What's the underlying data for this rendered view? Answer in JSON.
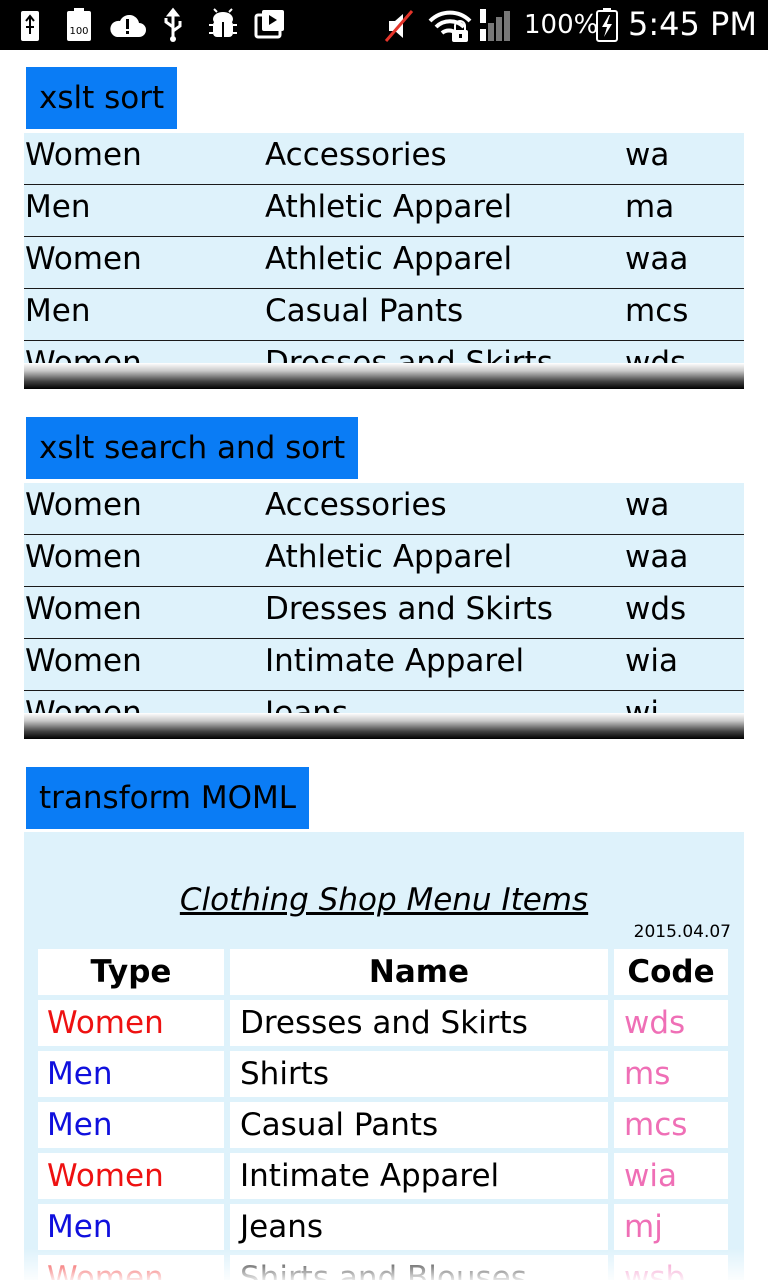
{
  "status_bar": {
    "battery_percent": "100%",
    "time": "5:45 PM",
    "icons": [
      "usb-icon",
      "battery-100-icon",
      "cloud-alert-icon",
      "usb-debug-icon",
      "android-bug-icon",
      "media-play-icon",
      "mute-icon",
      "wifi-lock-icon",
      "signal-icon",
      "charging-battery-icon"
    ]
  },
  "sections": [
    {
      "button_label": "xslt sort",
      "rows": [
        [
          "Women",
          "Accessories",
          "wa"
        ],
        [
          "Men",
          "Athletic Apparel",
          "ma"
        ],
        [
          "Women",
          "Athletic Apparel",
          "waa"
        ],
        [
          "Men",
          "Casual Pants",
          "mcs"
        ],
        [
          "Women",
          "Dresses and Skirts",
          "wds"
        ]
      ]
    },
    {
      "button_label": "xslt search and sort",
      "rows": [
        [
          "Women",
          "Accessories",
          "wa"
        ],
        [
          "Women",
          "Athletic Apparel",
          "waa"
        ],
        [
          "Women",
          "Dresses and Skirts",
          "wds"
        ],
        [
          "Women",
          "Intimate Apparel",
          "wia"
        ],
        [
          "Women",
          "Jeans",
          "wj"
        ]
      ]
    }
  ],
  "moml": {
    "button_label": "transform MOML",
    "title": "Clothing Shop Menu Items",
    "date": "2015.04.07",
    "headers": [
      "Type",
      "Name",
      "Code"
    ],
    "rows": [
      {
        "type": "Women",
        "name": "Dresses and Skirts",
        "code": "wds"
      },
      {
        "type": "Men",
        "name": "Shirts",
        "code": "ms"
      },
      {
        "type": "Men",
        "name": "Casual Pants",
        "code": "mcs"
      },
      {
        "type": "Women",
        "name": "Intimate Apparel",
        "code": "wia"
      },
      {
        "type": "Men",
        "name": "Jeans",
        "code": "mj"
      },
      {
        "type": "Women",
        "name": "Shirts and Blouses",
        "code": "wsb"
      }
    ],
    "colors": {
      "women": "#ee1111",
      "men": "#1010dd",
      "code": "#ef6fb6"
    }
  }
}
